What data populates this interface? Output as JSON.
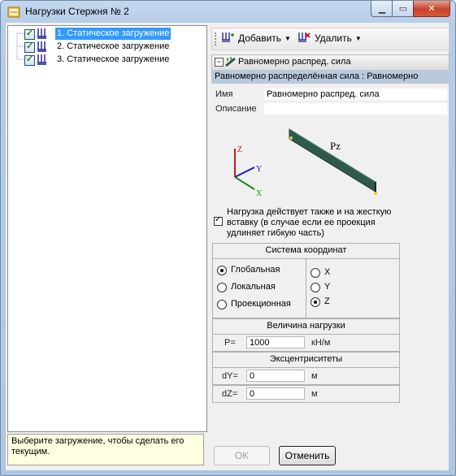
{
  "window": {
    "title": "Нагрузки  Стержня № 2"
  },
  "tree": {
    "items": [
      {
        "label": "1. Статическое загружение",
        "checked": true,
        "selected": true
      },
      {
        "label": "2. Статическое загружение",
        "checked": true,
        "selected": false
      },
      {
        "label": "3. Статическое загружение",
        "checked": true,
        "selected": false
      }
    ]
  },
  "hint": "Выберите загружение, чтобы сделать его текущим.",
  "toolbar": {
    "add_label": "Добавить",
    "delete_label": "Удалить"
  },
  "property": {
    "header": "Равномерно распред. сила",
    "subheader": "Равномерно распределённая сила : Равномерно",
    "name_label": "Имя",
    "name_value": "Равномерно распред. сила",
    "desc_label": "Описание",
    "desc_value": ""
  },
  "diagram": {
    "load_label": "Pz",
    "axis_z": "Z",
    "axis_y": "Y",
    "axis_x": "X"
  },
  "rigid_insert": {
    "checked": true,
    "text": "Нагрузка действует также и на жесткую вставку (в случае если ее проекция удлиняет гибкую часть)"
  },
  "coord_system": {
    "title": "Система координат",
    "systems": [
      {
        "label": "Глобальная",
        "selected": true
      },
      {
        "label": "Локальная",
        "selected": false
      },
      {
        "label": "Проекционная",
        "selected": false
      }
    ],
    "axes": [
      {
        "label": "X",
        "selected": false
      },
      {
        "label": "Y",
        "selected": false
      },
      {
        "label": "Z",
        "selected": true
      }
    ]
  },
  "magnitude": {
    "title": "Величина нагрузки",
    "label": "P=",
    "value": "1000",
    "unit": "кН/м"
  },
  "eccentricities": {
    "title": "Эксцентриситеты",
    "dy_label": "dY=",
    "dy_value": "0",
    "dy_unit": "м",
    "dz_label": "dZ=",
    "dz_value": "0",
    "dz_unit": "м"
  },
  "buttons": {
    "ok": "OK",
    "cancel": "Отменить"
  },
  "colors": {
    "selection": "#3399ff",
    "beam": "#2f5a4a",
    "hint_bg": "#ffffe1"
  }
}
